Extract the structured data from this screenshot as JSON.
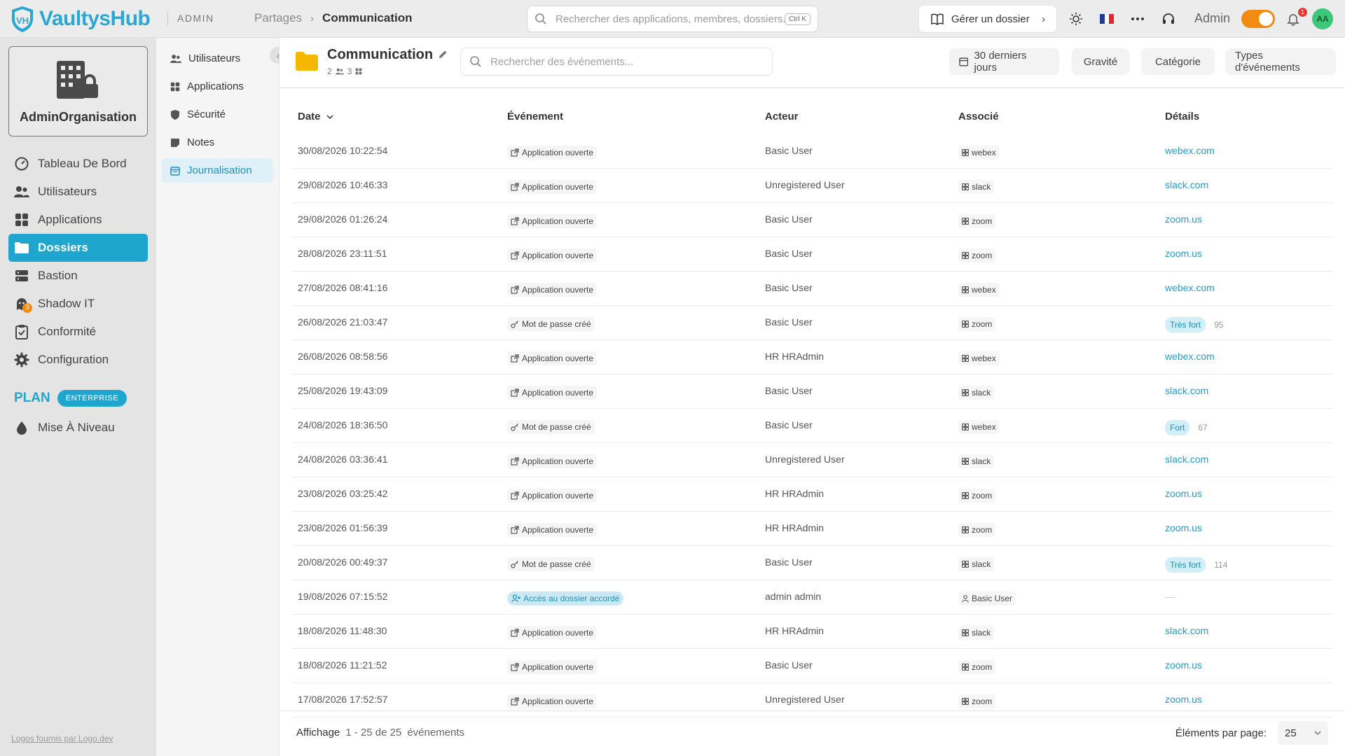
{
  "app": {
    "brand": "VaultysHub",
    "section": "ADMIN"
  },
  "breadcrumb": {
    "prev": "Partages",
    "current": "Communication"
  },
  "top_search": {
    "placeholder": "Rechercher des applications, membres, dossiers...",
    "shortcut": "Ctrl K"
  },
  "manage_folder": {
    "label": "Gérer un dossier"
  },
  "user": {
    "name": "Admin",
    "initials": "AA",
    "notifications": "1"
  },
  "sidebar": {
    "org_name": "AdminOrganisation",
    "items": [
      {
        "label": "Tableau De Bord",
        "icon": "dashboard-icon"
      },
      {
        "label": "Utilisateurs",
        "icon": "users-icon"
      },
      {
        "label": "Applications",
        "icon": "apps-icon"
      },
      {
        "label": "Dossiers",
        "icon": "folder-icon"
      },
      {
        "label": "Bastion",
        "icon": "server-icon"
      },
      {
        "label": "Shadow IT",
        "icon": "ghost-icon",
        "badge": "3"
      },
      {
        "label": "Conformité",
        "icon": "clipboard-icon"
      },
      {
        "label": "Configuration",
        "icon": "gear-icon"
      }
    ],
    "plan_label": "PLAN",
    "plan_tier": "ENTERPRISE",
    "upgrade": "Mise À Niveau",
    "logo_credit": "Logos fournis par Logo.dev"
  },
  "subnav": {
    "items": [
      {
        "label": "Utilisateurs"
      },
      {
        "label": "Applications"
      },
      {
        "label": "Sécurité"
      },
      {
        "label": "Notes"
      },
      {
        "label": "Journalisation"
      }
    ]
  },
  "folder": {
    "title": "Communication",
    "members": "2",
    "apps": "3"
  },
  "event_search": {
    "placeholder": "Rechercher des événements..."
  },
  "filters": {
    "period": "30 derniers jours",
    "severity": "Gravité",
    "category": "Catégorie",
    "types": "Types d'événements"
  },
  "table": {
    "headers": {
      "date": "Date",
      "event": "Événement",
      "actor": "Acteur",
      "associated": "Associé",
      "details": "Détails"
    },
    "rows": [
      {
        "date": "30/08/2026 10:22:54",
        "event": "Application ouverte",
        "actor": "Basic User",
        "assoc": "webex",
        "details": "webex.com"
      },
      {
        "date": "29/08/2026 10:46:33",
        "event": "Application ouverte",
        "actor": "Unregistered User",
        "assoc": "slack",
        "details": "slack.com"
      },
      {
        "date": "29/08/2026 01:26:24",
        "event": "Application ouverte",
        "actor": "Basic User",
        "assoc": "zoom",
        "details": "zoom.us"
      },
      {
        "date": "28/08/2026 23:11:51",
        "event": "Application ouverte",
        "actor": "Basic User",
        "assoc": "zoom",
        "details": "zoom.us"
      },
      {
        "date": "27/08/2026 08:41:16",
        "event": "Application ouverte",
        "actor": "Basic User",
        "assoc": "webex",
        "details": "webex.com"
      },
      {
        "date": "26/08/2026 21:03:47",
        "event": "Mot de passe créé",
        "actor": "Basic User",
        "assoc": "zoom",
        "strength": "Très fort",
        "score": "95"
      },
      {
        "date": "26/08/2026 08:58:56",
        "event": "Application ouverte",
        "actor": "HR HRAdmin",
        "assoc": "webex",
        "details": "webex.com"
      },
      {
        "date": "25/08/2026 19:43:09",
        "event": "Application ouverte",
        "actor": "Basic User",
        "assoc": "slack",
        "details": "slack.com"
      },
      {
        "date": "24/08/2026 18:36:50",
        "event": "Mot de passe créé",
        "actor": "Basic User",
        "assoc": "webex",
        "strength": "Fort",
        "score": "67"
      },
      {
        "date": "24/08/2026 03:36:41",
        "event": "Application ouverte",
        "actor": "Unregistered User",
        "assoc": "slack",
        "details": "slack.com"
      },
      {
        "date": "23/08/2026 03:25:42",
        "event": "Application ouverte",
        "actor": "HR HRAdmin",
        "assoc": "zoom",
        "details": "zoom.us"
      },
      {
        "date": "23/08/2026 01:56:39",
        "event": "Application ouverte",
        "actor": "HR HRAdmin",
        "assoc": "zoom",
        "details": "zoom.us"
      },
      {
        "date": "20/08/2026 00:49:37",
        "event": "Mot de passe créé",
        "actor": "Basic User",
        "assoc": "slack",
        "strength": "Très fort",
        "score": "114"
      },
      {
        "date": "19/08/2026 07:15:52",
        "event": "Accès au dossier accordé",
        "actor": "admin admin",
        "assoc": "Basic User",
        "assoc_kind": "user",
        "details": "—",
        "kind": "access"
      },
      {
        "date": "18/08/2026 11:48:30",
        "event": "Application ouverte",
        "actor": "HR HRAdmin",
        "assoc": "slack",
        "details": "slack.com"
      },
      {
        "date": "18/08/2026 11:21:52",
        "event": "Application ouverte",
        "actor": "Basic User",
        "assoc": "zoom",
        "details": "zoom.us"
      },
      {
        "date": "17/08/2026 17:52:57",
        "event": "Application ouverte",
        "actor": "Unregistered User",
        "assoc": "zoom",
        "details": "zoom.us"
      }
    ]
  },
  "footer": {
    "display_label": "Affichage",
    "range": "1 - 25 de 25",
    "unit": "événements",
    "per_page_label": "Éléments par page:",
    "per_page": "25"
  },
  "colors": {
    "accent": "#1fa6cf",
    "toggle": "#f28b12",
    "avatar": "#3cc878"
  }
}
